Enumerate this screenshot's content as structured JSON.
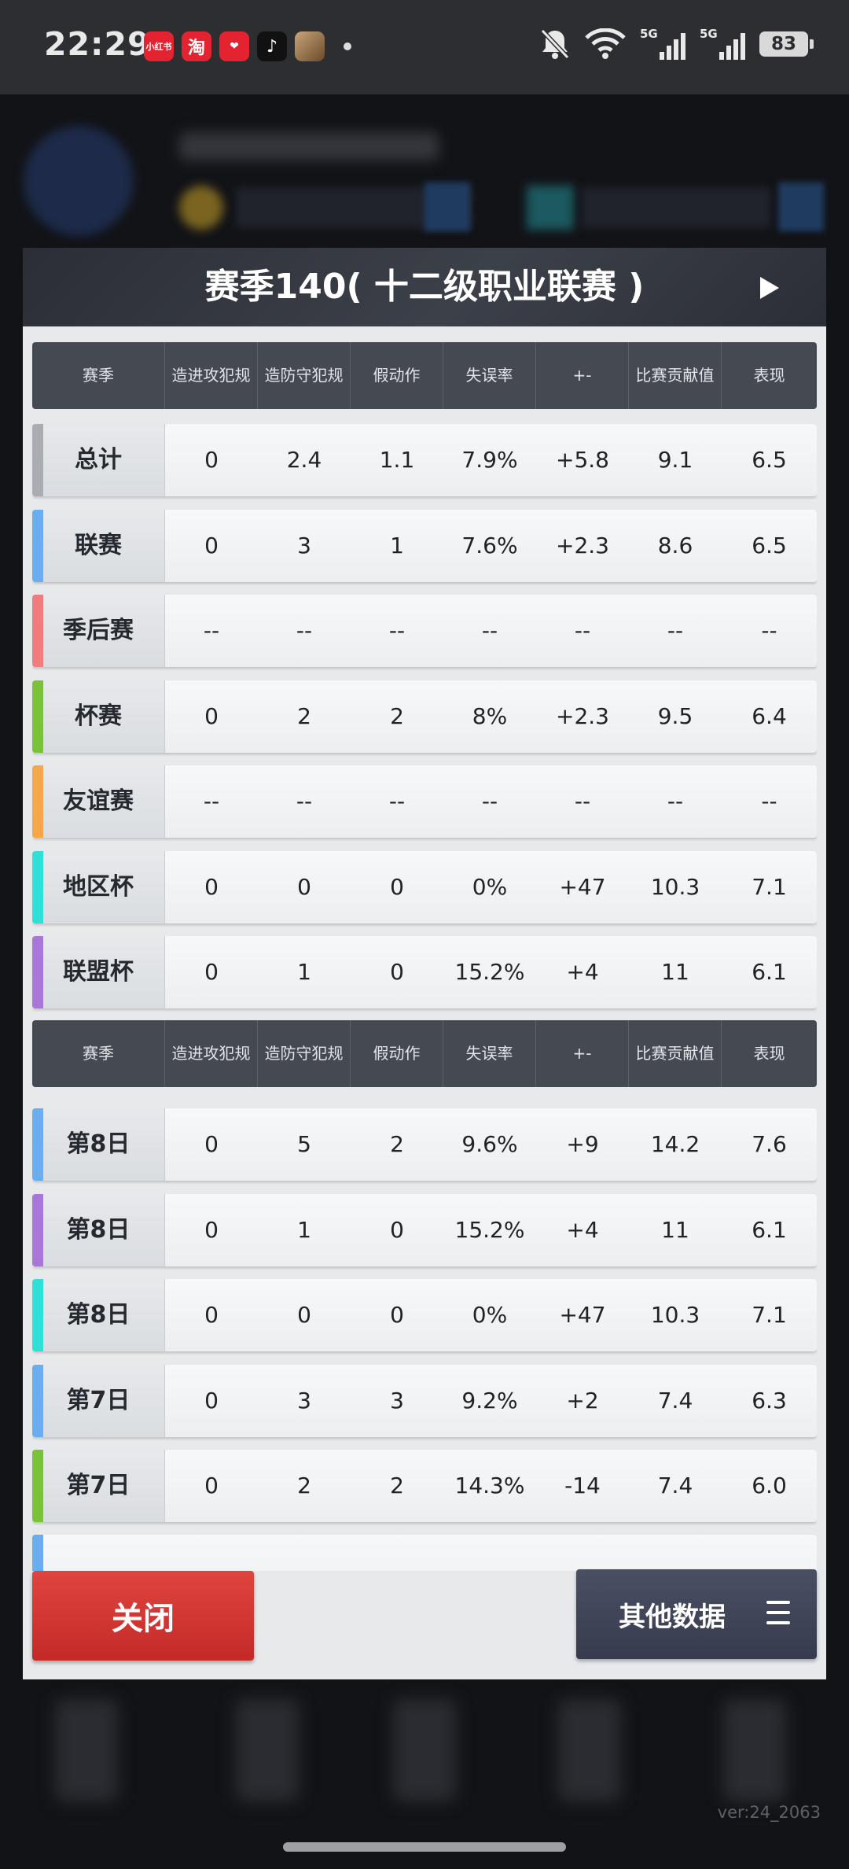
{
  "status_bar": {
    "time": "22:29",
    "apps": [
      "小红书",
      "淘",
      "❤",
      "♪",
      ""
    ],
    "network1": "5G",
    "network2": "5G",
    "battery": "83"
  },
  "dialog": {
    "title": "赛季140( 十二级职业联赛 )",
    "columns": [
      "赛季",
      "造进攻犯规",
      "造防守犯规",
      "假动作",
      "失误率",
      "+-",
      "比赛贡献值",
      "表现"
    ],
    "summary_rows": [
      {
        "name": "总计",
        "color": "#a9acb0",
        "cells": [
          "0",
          "2.4",
          "1.1",
          "7.9%",
          "+5.8",
          "9.1",
          "6.5"
        ]
      },
      {
        "name": "联赛",
        "color": "#6aaef0",
        "cells": [
          "0",
          "3",
          "1",
          "7.6%",
          "+2.3",
          "8.6",
          "6.5"
        ]
      },
      {
        "name": "季后赛",
        "color": "#f07d7d",
        "cells": [
          "--",
          "--",
          "--",
          "--",
          "--",
          "--",
          "--"
        ]
      },
      {
        "name": "杯赛",
        "color": "#7ac23a",
        "cells": [
          "0",
          "2",
          "2",
          "8%",
          "+2.3",
          "9.5",
          "6.4"
        ]
      },
      {
        "name": "友谊赛",
        "color": "#f5a74a",
        "cells": [
          "--",
          "--",
          "--",
          "--",
          "--",
          "--",
          "--"
        ]
      },
      {
        "name": "地区杯",
        "color": "#2fe0d8",
        "cells": [
          "0",
          "0",
          "0",
          "0%",
          "+47",
          "10.3",
          "7.1"
        ]
      },
      {
        "name": "联盟杯",
        "color": "#a877d8",
        "cells": [
          "0",
          "1",
          "0",
          "15.2%",
          "+4",
          "11",
          "6.1"
        ]
      }
    ],
    "game_rows": [
      {
        "name": "第8日",
        "color": "#6aaef0",
        "cells": [
          "0",
          "5",
          "2",
          "9.6%",
          "+9",
          "14.2",
          "7.6"
        ]
      },
      {
        "name": "第8日",
        "color": "#a877d8",
        "cells": [
          "0",
          "1",
          "0",
          "15.2%",
          "+4",
          "11",
          "6.1"
        ]
      },
      {
        "name": "第8日",
        "color": "#2fe0d8",
        "cells": [
          "0",
          "0",
          "0",
          "0%",
          "+47",
          "10.3",
          "7.1"
        ]
      },
      {
        "name": "第7日",
        "color": "#6aaef0",
        "cells": [
          "0",
          "3",
          "3",
          "9.2%",
          "+2",
          "7.4",
          "6.3"
        ]
      },
      {
        "name": "第7日",
        "color": "#7ac23a",
        "cells": [
          "0",
          "2",
          "2",
          "14.3%",
          "-14",
          "7.4",
          "6.0"
        ]
      }
    ],
    "close_label": "关闭",
    "other_label": "其他数据"
  },
  "version": "ver:24_2063"
}
